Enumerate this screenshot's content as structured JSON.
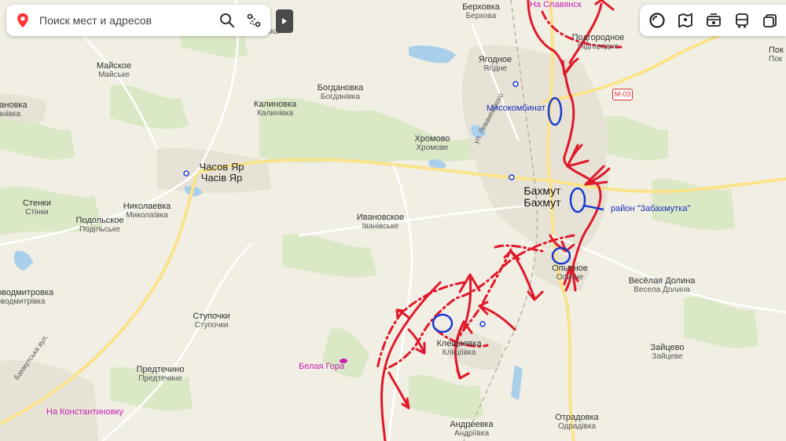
{
  "search": {
    "placeholder": "Поиск мест и адресов"
  },
  "icons": {
    "location": "location-pin-icon",
    "search": "search-icon",
    "route": "route-icon",
    "collapse": "play-icon",
    "layers": "layers-icon",
    "panorama": "panorama-icon",
    "transit": "transit-icon",
    "bus": "bus-icon",
    "more": "more-icon"
  },
  "colors": {
    "front": "#e0192a",
    "marker": "#1a3bd1",
    "blue_text": "#1a2fb8",
    "pink_text": "#c51fb3"
  },
  "road_badge": "M-03",
  "places": [
    {
      "primary": "Берховка",
      "secondary": "Берхова"
    },
    {
      "primary": "Григоровка",
      "secondary": "Григорівка"
    },
    {
      "primary": "Майское",
      "secondary": "Майське"
    },
    {
      "primary": "Богдановка",
      "secondary": "Богданівка"
    },
    {
      "primary": "Калиновка",
      "secondary": "Калинівка"
    },
    {
      "primary": "Ягодное",
      "secondary": "Ягідне"
    },
    {
      "primary": "Подгородное",
      "secondary": "Підгородне"
    },
    {
      "primary": "Богдановка",
      "secondary": "Богданівка"
    },
    {
      "primary": "Хромово",
      "secondary": "Хромове"
    },
    {
      "primary": "Часов Яр",
      "secondary": "Часів Яр"
    },
    {
      "primary": "Бахмут",
      "secondary": "Бахмут"
    },
    {
      "primary": "Стенки",
      "secondary": "Стінки"
    },
    {
      "primary": "Николаевка",
      "secondary": "Миколаївка"
    },
    {
      "primary": "Подольское",
      "secondary": "Подільське"
    },
    {
      "primary": "Ивановское",
      "secondary": "Іванівське"
    },
    {
      "primary": "Опытное",
      "secondary": "Опитне"
    },
    {
      "primary": "Весёлая Долина",
      "secondary": "Весела Долина"
    },
    {
      "primary": "Новодмитровка",
      "secondary": "Новодмитрівка"
    },
    {
      "primary": "Ступочки",
      "secondary": "Ступочки"
    },
    {
      "primary": "Клещеевка",
      "secondary": "Кліщіївка"
    },
    {
      "primary": "Зайцево",
      "secondary": "Зайцеве"
    },
    {
      "primary": "Предтечино",
      "secondary": "Предтечине"
    },
    {
      "primary": "Андреевка",
      "secondary": "Андріївка"
    },
    {
      "primary": "Отрадовка",
      "secondary": "Одрадівка"
    },
    {
      "primary": "Пок",
      "secondary": "Пок"
    }
  ],
  "streets": {
    "levanevsky": "ул. Леваневского",
    "road_sw": "Бахмутська вул."
  },
  "annotations": {
    "to_slavyansk": "На Славянск",
    "meat_plant": "Мясокомбинат",
    "zabakhmutka": "район \"Забахмутка\"",
    "belaya_gora": "Белая Гора",
    "to_konstantinovka": "На Константиновку"
  }
}
